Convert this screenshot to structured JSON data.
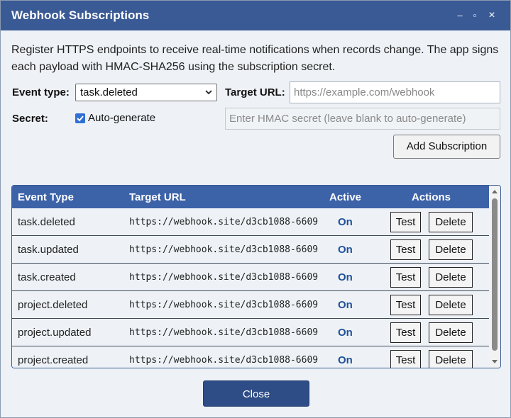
{
  "window": {
    "title": "Webhook Subscriptions",
    "controls": {
      "minimize": "–",
      "maximize": "▫",
      "close": "×"
    }
  },
  "description": "Register HTTPS endpoints to receive real-time notifications when records change. The app signs each payload with HMAC-SHA256 using the subscription secret.",
  "form": {
    "event_type_label": "Event type:",
    "event_type_value": "task.deleted",
    "target_url_label": "Target URL:",
    "target_url_placeholder": "https://example.com/webhook",
    "secret_label": "Secret:",
    "auto_generate_label": "Auto-generate",
    "auto_generate_checked": true,
    "secret_placeholder": "Enter HMAC secret (leave blank to auto-generate)",
    "add_button": "Add Subscription"
  },
  "table": {
    "headers": {
      "event_type": "Event Type",
      "target_url": "Target URL",
      "active": "Active",
      "actions": "Actions"
    },
    "rows": [
      {
        "event": "task.deleted",
        "url": "https://webhook.site/d3cb1088-6609",
        "active": "On",
        "test": "Test",
        "delete": "Delete"
      },
      {
        "event": "task.updated",
        "url": "https://webhook.site/d3cb1088-6609",
        "active": "On",
        "test": "Test",
        "delete": "Delete"
      },
      {
        "event": "task.created",
        "url": "https://webhook.site/d3cb1088-6609",
        "active": "On",
        "test": "Test",
        "delete": "Delete"
      },
      {
        "event": "project.deleted",
        "url": "https://webhook.site/d3cb1088-6609",
        "active": "On",
        "test": "Test",
        "delete": "Delete"
      },
      {
        "event": "project.updated",
        "url": "https://webhook.site/d3cb1088-6609",
        "active": "On",
        "test": "Test",
        "delete": "Delete"
      },
      {
        "event": "project.created",
        "url": "https://webhook.site/d3cb1088-6609",
        "active": "On",
        "test": "Test",
        "delete": "Delete"
      }
    ]
  },
  "close_button": "Close",
  "colors": {
    "title_bar": "#3a5a95",
    "table_header": "#3c62a8",
    "active_text": "#1f4f9a",
    "close_button": "#2e4c85"
  }
}
